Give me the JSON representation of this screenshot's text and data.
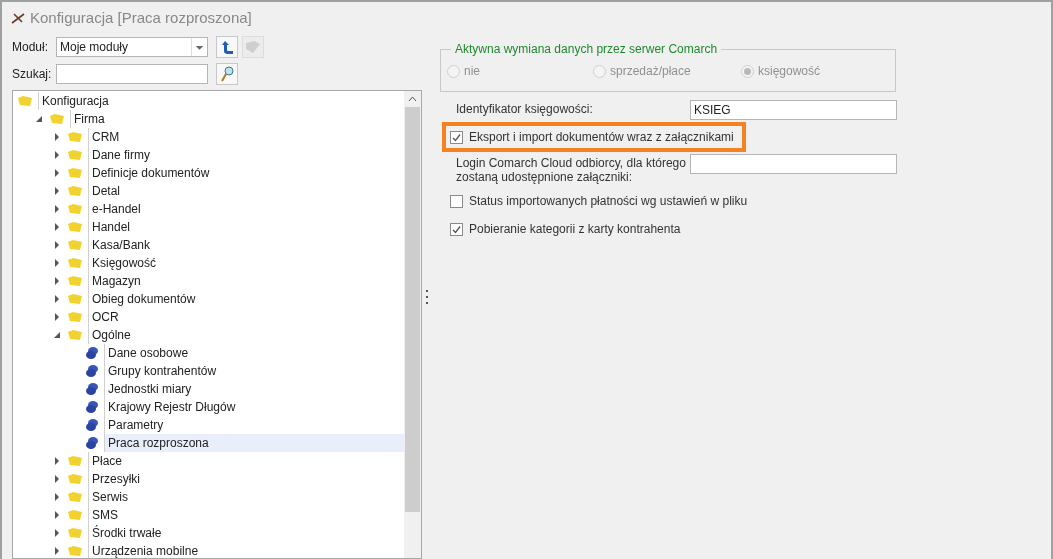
{
  "window": {
    "title": "Konfiguracja [Praca rozproszona]"
  },
  "module": {
    "label": "Moduł:",
    "value": "Moje moduły"
  },
  "search": {
    "label": "Szukaj:"
  },
  "tree": [
    {
      "label": "Konfiguracja",
      "kind": "folder",
      "selected": false,
      "children": [
        {
          "label": "Firma",
          "kind": "folder",
          "expanded": true,
          "selected": false,
          "children": [
            {
              "label": "CRM",
              "kind": "folder",
              "expanded": false,
              "selected": false
            },
            {
              "label": "Dane firmy",
              "kind": "folder",
              "expanded": false,
              "selected": false
            },
            {
              "label": "Definicje dokumentów",
              "kind": "folder",
              "expanded": false,
              "selected": false
            },
            {
              "label": "Detal",
              "kind": "folder",
              "expanded": false,
              "selected": false
            },
            {
              "label": "e-Handel",
              "kind": "folder",
              "expanded": false,
              "selected": false
            },
            {
              "label": "Handel",
              "kind": "folder",
              "expanded": false,
              "selected": false
            },
            {
              "label": "Kasa/Bank",
              "kind": "folder",
              "expanded": false,
              "selected": false
            },
            {
              "label": "Księgowość",
              "kind": "folder",
              "expanded": false,
              "selected": false
            },
            {
              "label": "Magazyn",
              "kind": "folder",
              "expanded": false,
              "selected": false
            },
            {
              "label": "Obieg dokumentów",
              "kind": "folder",
              "expanded": false,
              "selected": false
            },
            {
              "label": "OCR",
              "kind": "folder",
              "expanded": false,
              "selected": false
            },
            {
              "label": "Ogólne",
              "kind": "folder",
              "expanded": true,
              "selected": false,
              "children": [
                {
                  "label": "Dane osobowe",
                  "kind": "leaf",
                  "selected": false
                },
                {
                  "label": "Grupy kontrahentów",
                  "kind": "leaf",
                  "selected": false
                },
                {
                  "label": "Jednostki miary",
                  "kind": "leaf",
                  "selected": false
                },
                {
                  "label": "Krajowy Rejestr Długów",
                  "kind": "leaf",
                  "selected": false
                },
                {
                  "label": "Parametry",
                  "kind": "leaf",
                  "selected": false
                },
                {
                  "label": "Praca rozproszona",
                  "kind": "leaf",
                  "selected": true
                }
              ]
            },
            {
              "label": "Płace",
              "kind": "folder",
              "expanded": false,
              "selected": false
            },
            {
              "label": "Przesyłki",
              "kind": "folder",
              "expanded": false,
              "selected": false
            },
            {
              "label": "Serwis",
              "kind": "folder",
              "expanded": false,
              "selected": false
            },
            {
              "label": "SMS",
              "kind": "folder",
              "expanded": false,
              "selected": false
            },
            {
              "label": "Środki trwałe",
              "kind": "folder",
              "expanded": false,
              "selected": false
            },
            {
              "label": "Urządzenia mobilne",
              "kind": "folder",
              "expanded": false,
              "selected": false
            }
          ]
        }
      ]
    }
  ],
  "exchange": {
    "title": "Aktywna wymiana danych przez serwer Comarch",
    "disabled": true,
    "options": [
      {
        "label": "nie",
        "selected": false
      },
      {
        "label": "sprzedaż/płace",
        "selected": false
      },
      {
        "label": "księgowość",
        "selected": true
      }
    ]
  },
  "settings": [
    {
      "kind": "field",
      "label": "Identyfikator księgowości:",
      "value": "KSIEG"
    },
    {
      "kind": "checkbox",
      "label": "Eksport i import dokumentów wraz z załącznikami",
      "checked": true,
      "highlighted": true
    },
    {
      "kind": "field",
      "label": "Login Comarch Cloud odbiorcy, dla którego zostaną udostępnione załączniki:"
    },
    {
      "kind": "checkbox",
      "label": "Status importowanych płatności wg ustawień w pliku",
      "checked": false,
      "highlighted": false
    },
    {
      "kind": "checkbox",
      "label": "Pobieranie kategorii z karty kontrahenta",
      "checked": true,
      "highlighted": false
    }
  ]
}
